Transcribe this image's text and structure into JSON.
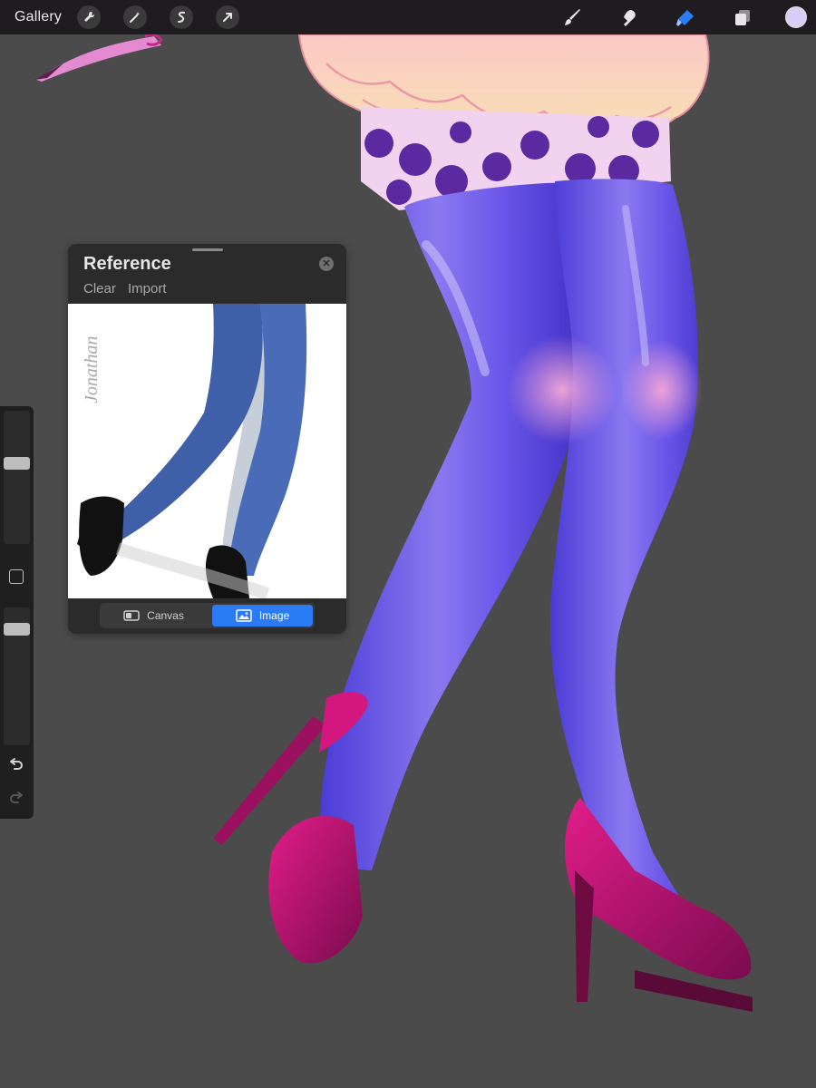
{
  "topbar": {
    "gallery_label": "Gallery",
    "actions": [
      {
        "name": "wrench-icon"
      },
      {
        "name": "magic-wand-icon"
      },
      {
        "name": "selection-icon"
      },
      {
        "name": "transform-arrow-icon"
      }
    ],
    "tools": [
      {
        "name": "brush-icon"
      },
      {
        "name": "smudge-icon"
      },
      {
        "name": "eraser-icon",
        "active": true
      },
      {
        "name": "layers-icon"
      }
    ],
    "current_color": "#d7cdf6",
    "accent_color": "#2b7cf4"
  },
  "reference_panel": {
    "title": "Reference",
    "actions": [
      "Clear",
      "Import"
    ],
    "image_watermark": "Jonathan",
    "modes": [
      "Canvas",
      "Image"
    ],
    "active_mode": "Image"
  },
  "sidebar": {
    "brush_size_level": 0.62,
    "opacity_level": 0.88,
    "icons": [
      "modify-square-icon",
      "undo-icon",
      "redo-icon"
    ]
  }
}
